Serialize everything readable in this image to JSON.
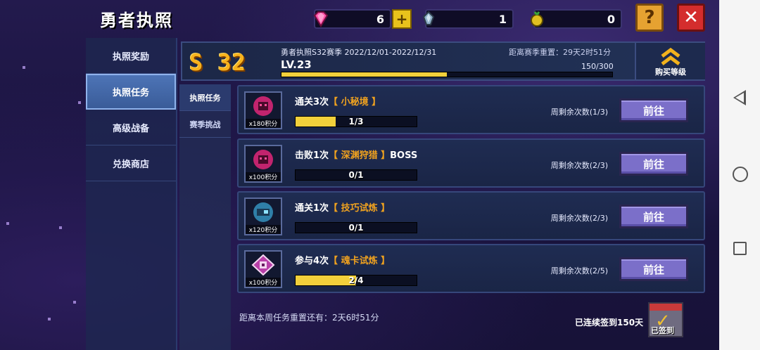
{
  "header": {
    "title": "勇者执照",
    "currency": [
      {
        "name": "gem",
        "value": "6"
      },
      {
        "name": "crystal",
        "value": "1"
      },
      {
        "name": "seed",
        "value": "0"
      }
    ],
    "plus_label": "+",
    "help_label": "?",
    "close_label": "✕"
  },
  "left_nav": {
    "items": [
      {
        "label": "执照奖励"
      },
      {
        "label": "执照任务"
      },
      {
        "label": "高级战备"
      },
      {
        "label": "兑换商店"
      }
    ],
    "active_index": 1
  },
  "sub_nav": {
    "items": [
      {
        "label": "执照任务"
      },
      {
        "label": "赛季挑战"
      }
    ],
    "active_index": 0
  },
  "season": {
    "badge": "S 32",
    "name": "勇者执照S32赛季 2022/12/01-2022/12/31",
    "reset": "距离赛季重置：29天2时51分",
    "level": "LV.23",
    "xp_text": "150/300",
    "xp_fraction": 0.5,
    "buy_level_label": "购买等级"
  },
  "tasks": [
    {
      "prefix": "通关3次",
      "highlight": "【 小秘境 】",
      "suffix": "",
      "points": "x180积分",
      "progress_text": "1/3",
      "progress_fraction": 0.333,
      "weekly": "周剩余次数(1/3)",
      "button": "前往",
      "icon": "demon-mask-icon"
    },
    {
      "prefix": "击败1次",
      "highlight": "【 深渊狩猎 】",
      "suffix": "BOSS",
      "points": "x100积分",
      "progress_text": "0/1",
      "progress_fraction": 0,
      "weekly": "周剩余次数(2/3)",
      "button": "前往",
      "icon": "demon-mask-icon"
    },
    {
      "prefix": "通关1次",
      "highlight": "【 技巧试炼 】",
      "suffix": "",
      "points": "x120积分",
      "progress_text": "0/1",
      "progress_fraction": 0,
      "weekly": "周剩余次数(2/3)",
      "button": "前往",
      "icon": "robot-head-icon"
    },
    {
      "prefix": "参与4次",
      "highlight": "【 魂卡试炼 】",
      "suffix": "",
      "points": "x100积分",
      "progress_text": "2/4",
      "progress_fraction": 0.5,
      "weekly": "周剩余次数(2/5)",
      "button": "前往",
      "icon": "soul-card-icon"
    }
  ],
  "footer": {
    "reset_note": "距离本周任务重置还有：2天6时51分",
    "checkin": "已连续签到150天",
    "signed_label": "已签到"
  },
  "colors": {
    "accent_yellow": "#f2d03b",
    "highlight_orange": "#f0a21f",
    "button_purple": "#7b6fc9",
    "close_red": "#d42d2d"
  }
}
